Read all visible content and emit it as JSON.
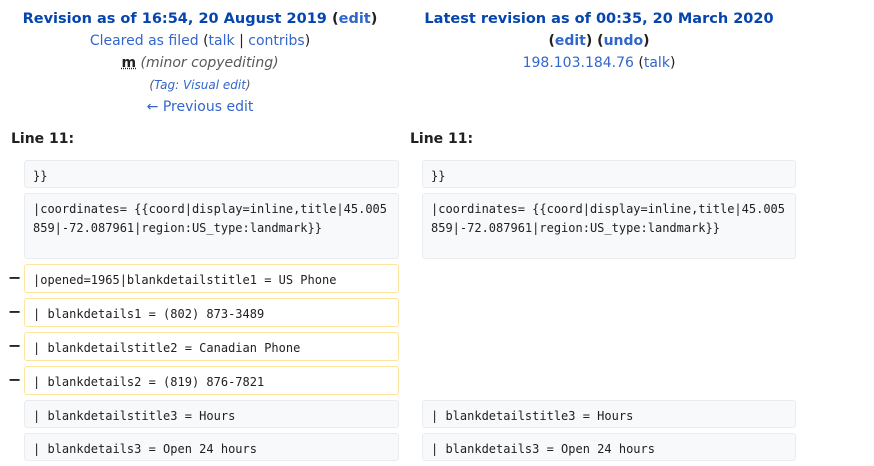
{
  "left_header": {
    "title_text": "Revision as of 16:54, 20 August 2019",
    "title_open": "(",
    "edit": "edit",
    "title_close": ")",
    "user": "Cleared as filed",
    "talk_open": "(",
    "talk": "talk",
    "sep": "|",
    "contribs": "contribs",
    "talk_close": ")",
    "minor_mark": "m",
    "summary": "(minor copyediting)",
    "tag_open": "(",
    "tag_label": "Tag: ",
    "tag_value": "Visual edit",
    "tag_close": ")",
    "prev_edit": "← Previous edit"
  },
  "right_header": {
    "title_text": "Latest revision as of 00:35, 20 March 2020",
    "edit_open": "(",
    "edit": "edit",
    "edit_close": ")",
    "undo_open": "(",
    "undo": "undo",
    "undo_close": ")",
    "user": "198.103.184.76",
    "talk_open": "(",
    "talk": "talk",
    "talk_close": ")"
  },
  "line_label_left": "Line 11:",
  "line_label_right": "Line 11:",
  "diff_rows": {
    "r0": {
      "left": "}}",
      "right": "}}"
    },
    "r1": {
      "left": "|coordinates= {{coord|display=inline,title|45.005859|-72.087961|region:US_type:landmark}}",
      "right": "|coordinates= {{coord|display=inline,title|45.005859|-72.087961|region:US_type:landmark}}"
    },
    "r2": {
      "left": "|opened=1965|blankdetailstitle1 = US Phone",
      "marker": "−"
    },
    "r3": {
      "left": "| blankdetails1 = (802) 873-3489",
      "marker": "−"
    },
    "r4": {
      "left": "| blankdetailstitle2 = Canadian Phone",
      "marker": "−"
    },
    "r5": {
      "left": "| blankdetails2 = (819) 876-7821",
      "marker": "−"
    },
    "r6": {
      "left": "| blankdetailstitle3 = Hours",
      "right": "| blankdetailstitle3 = Hours"
    },
    "r7": {
      "left": "| blankdetails3 = Open 24 hours",
      "right": "| blankdetails3 = Open 24 hours"
    }
  },
  "colors": {
    "link": "#3366cc",
    "title_link": "#0645ad",
    "deleted_border": "#ffe49c",
    "context_bg": "#f8f9fa"
  }
}
